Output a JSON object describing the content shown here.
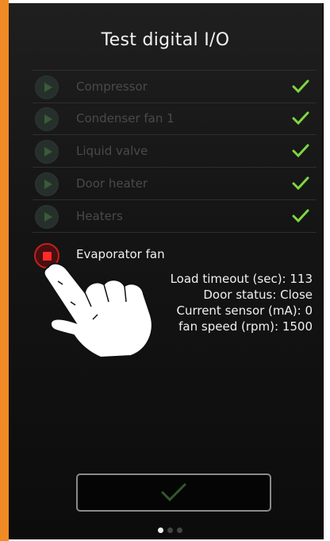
{
  "screen": {
    "title": "Test digital I/O"
  },
  "items": [
    {
      "label": "Compressor",
      "status": "ok"
    },
    {
      "label": "Condenser fan 1",
      "status": "ok"
    },
    {
      "label": "Liquid valve",
      "status": "ok"
    },
    {
      "label": "Door heater",
      "status": "ok"
    },
    {
      "label": "Heaters",
      "status": "ok"
    }
  ],
  "active_item": {
    "label": "Evaporator fan",
    "details": [
      "Load timeout (sec): 113",
      "Door status: Close",
      "Current sensor (mA): 0",
      "fan speed (rpm): 1500"
    ]
  },
  "pager": {
    "pages": 3,
    "current": 1
  },
  "colors": {
    "accent_orange": "#f08a24",
    "check_green": "#7fd63f",
    "stop_red": "#ff2a2a"
  }
}
